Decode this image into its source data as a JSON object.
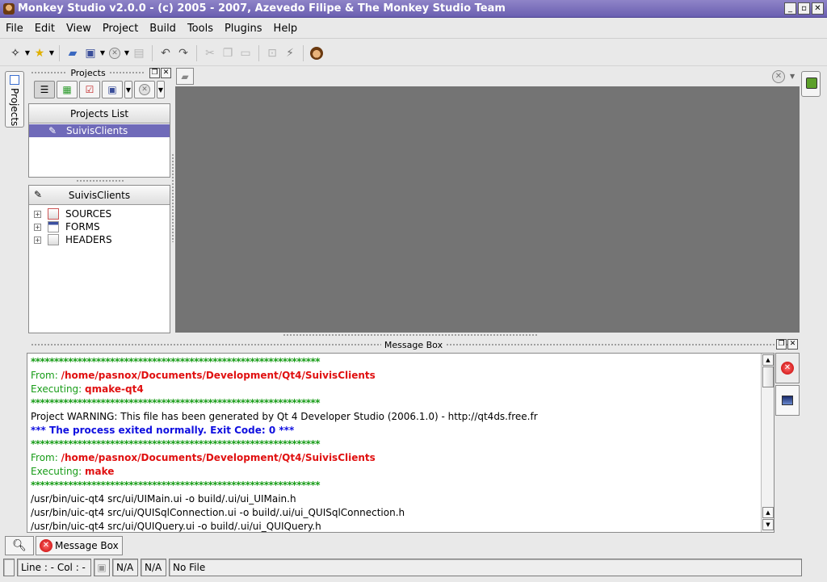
{
  "window": {
    "title": "Monkey Studio v2.0.0 - (c) 2005 - 2007, Azevedo Filipe & The Monkey Studio Team"
  },
  "menu": [
    "File",
    "Edit",
    "View",
    "Project",
    "Build",
    "Tools",
    "Plugins",
    "Help"
  ],
  "toolbar": {
    "icons": [
      "new-icon",
      "favorite-star-icon",
      "open-folder-icon",
      "save-icon",
      "close-icon",
      "print-icon",
      "undo-icon",
      "redo-icon",
      "cut-icon",
      "copy-icon",
      "paste-icon",
      "search-replace-icon",
      "build-icon",
      "monkey-icon"
    ]
  },
  "side_tabs": {
    "left": "Projects"
  },
  "projects_dock": {
    "title": "Projects",
    "list_header": "Projects List",
    "selected_project": "SuivisClients",
    "tree_header": "SuivisClients",
    "tree_items": [
      "SOURCES",
      "FORMS",
      "HEADERS"
    ]
  },
  "message_box": {
    "title": "Message Box",
    "lines": [
      {
        "type": "stars",
        "text": "**************************************************************"
      },
      {
        "type": "from",
        "label": "From: ",
        "value": "/home/pasnox/Documents/Development/Qt4/SuivisClients"
      },
      {
        "type": "exec",
        "label": "Executing: ",
        "value": "qmake-qt4"
      },
      {
        "type": "stars",
        "text": "**************************************************************"
      },
      {
        "type": "plain",
        "text": "Project WARNING: This file has been generated by Qt 4 Developer Studio (2006.1.0) - http://qt4ds.free.fr"
      },
      {
        "type": "blue",
        "text": "*** The process exited normally. Exit Code: 0 ***"
      },
      {
        "type": "stars",
        "text": "**************************************************************"
      },
      {
        "type": "from",
        "label": "From: ",
        "value": "/home/pasnox/Documents/Development/Qt4/SuivisClients"
      },
      {
        "type": "exec",
        "label": "Executing: ",
        "value": "make"
      },
      {
        "type": "stars",
        "text": "**************************************************************"
      },
      {
        "type": "plain",
        "text": "/usr/bin/uic-qt4 src/ui/UIMain.ui -o build/.ui/ui_UIMain.h"
      },
      {
        "type": "plain",
        "text": "/usr/bin/uic-qt4 src/ui/QUISqlConnection.ui -o build/.ui/ui_QUISqlConnection.h"
      },
      {
        "type": "plain",
        "text": "/usr/bin/uic-qt4 src/ui/QUIQuery.ui -o build/.ui/ui_QUIQuery.h"
      }
    ]
  },
  "bottom_tabs": {
    "message_box_tab": "Message Box"
  },
  "statusbar": {
    "position": "Line : - Col : -",
    "field1": "N/A",
    "field2": "N/A",
    "file": "No File"
  }
}
